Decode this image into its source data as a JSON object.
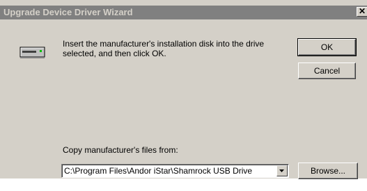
{
  "window": {
    "title": "Upgrade Device Driver Wizard",
    "close_glyph": "✕"
  },
  "message": {
    "text": "Insert the manufacturer's installation disk into the drive selected, and then click OK.",
    "icon": "floppy-drive-icon"
  },
  "buttons": {
    "ok_label": "OK",
    "cancel_label": "Cancel",
    "browse_label": "Browse..."
  },
  "copy_from": {
    "label": "Copy manufacturer's files from:",
    "value": "C:\\Program Files\\Andor iStar\\Shamrock USB Drive"
  },
  "colors": {
    "dialog_face": "#d4d0c8",
    "titlebar_inactive": "#808080",
    "titlebar_text": "#d4d0c8"
  }
}
